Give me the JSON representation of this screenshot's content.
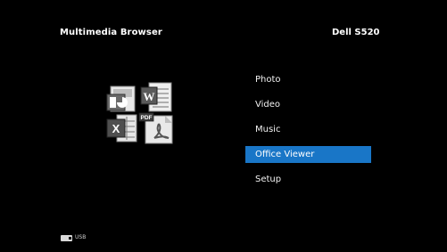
{
  "header": {
    "title": "Multimedia Browser",
    "model": "Dell S520"
  },
  "menu": {
    "items": [
      {
        "label": "Photo",
        "selected": false
      },
      {
        "label": "Video",
        "selected": false
      },
      {
        "label": "Music",
        "selected": false
      },
      {
        "label": "Office Viewer",
        "selected": true
      },
      {
        "label": "Setup",
        "selected": false
      }
    ]
  },
  "icons": {
    "cluster": [
      "powerpoint-document-icon",
      "word-document-icon",
      "excel-document-icon",
      "pdf-document-icon"
    ],
    "pdf_tag": "PDF"
  },
  "footer": {
    "source_label": "USB",
    "source_icon": "usb-drive-icon"
  },
  "colors": {
    "background": "#000000",
    "selection": "#1976c7",
    "text": "#ffffff"
  }
}
